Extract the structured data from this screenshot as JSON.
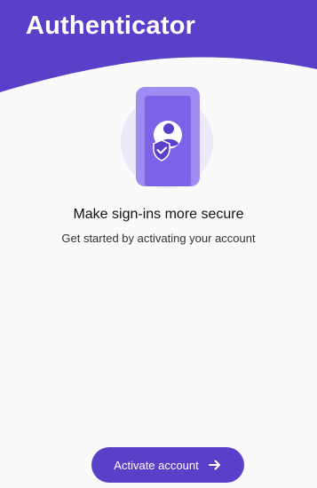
{
  "header": {
    "title": "Authenticator"
  },
  "onboarding": {
    "illustration_icon": "phone-account-shield-icon",
    "headline": "Make sign-ins more secure",
    "subtitle": "Get started by activating your account"
  },
  "actions": {
    "activate_label": "Activate account",
    "activate_icon": "arrow-right-icon"
  },
  "colors": {
    "accent": "#5a3fc9",
    "accent_light": "#9f8cf3",
    "illustration_bg": "#ece9f8",
    "background": "#fafafa"
  }
}
